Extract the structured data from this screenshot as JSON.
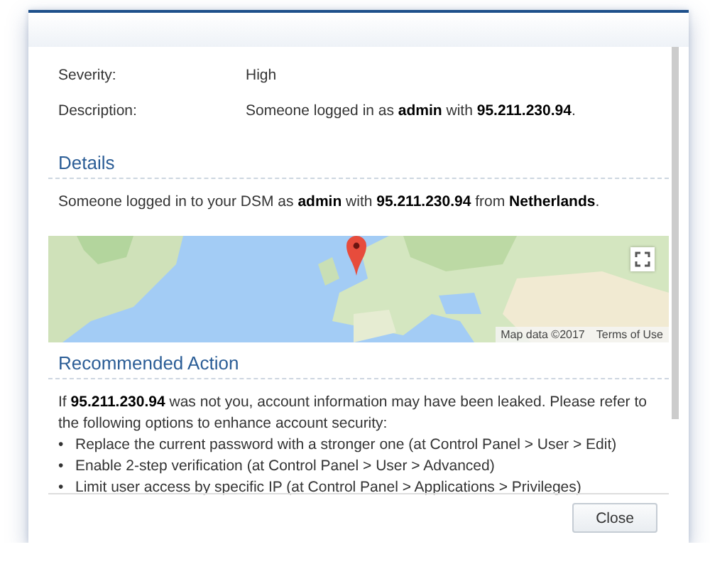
{
  "fields": [
    {
      "label": "Severity:",
      "value": "High"
    },
    {
      "label": "Description:",
      "value": "Someone logged in as **admin** with **95.211.230.94**."
    }
  ],
  "details": {
    "heading": "Details",
    "text": "Someone logged in to your DSM as **admin** with **95.211.230.94** from **Netherlands**.",
    "map": {
      "kind": "picture",
      "attribution": "Map data ©2017",
      "terms_link": "Terms of Use"
    }
  },
  "recommended_action": {
    "heading": "Recommended Action",
    "intro": "If **95.211.230.94** was not you, account information may have been leaked. Please refer to the following options to enhance account security:",
    "items": [
      {
        "bullet": "•",
        "text": "Replace the current password with a stronger one (at Control Panel > User > Edit)"
      },
      {
        "bullet": "•",
        "text": "Enable 2-step verification (at Control Panel > User > Advanced)"
      },
      {
        "bullet": "•",
        "text": "Limit user access by specific IP (at Control Panel > Applications > Privileges)"
      }
    ]
  },
  "buttons": [
    "Close"
  ]
}
